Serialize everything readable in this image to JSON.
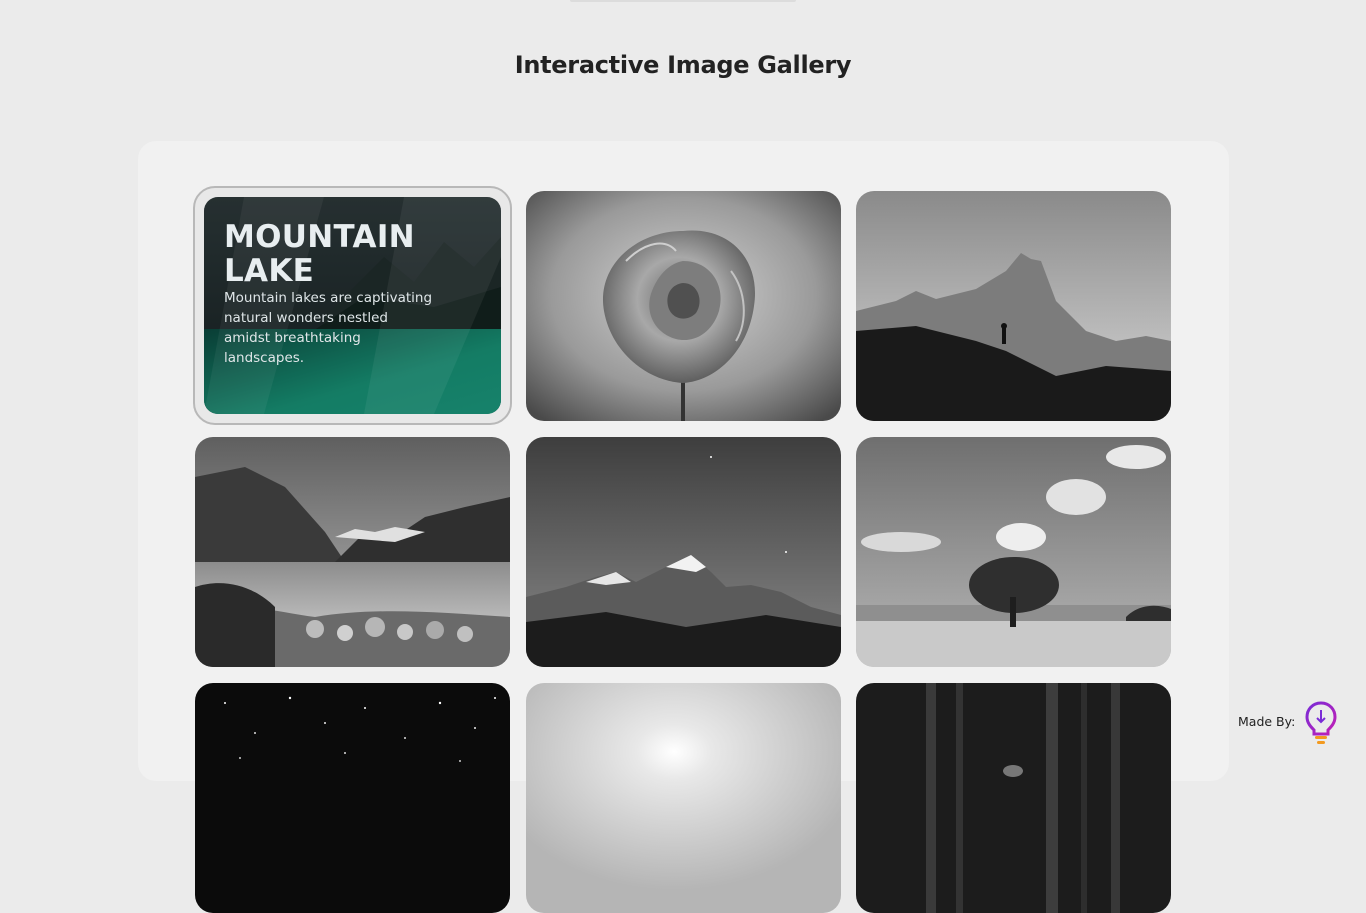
{
  "header": {
    "title": "Interactive Image Gallery"
  },
  "gallery": {
    "featured": {
      "title": "MOUNTAIN LAKE",
      "description": "Mountain lakes are captivating natural wonders nestled amidst breathtaking landscapes.",
      "accent": "#1fbf9a"
    },
    "images": [
      {
        "name": "mountain-lake"
      },
      {
        "name": "rose"
      },
      {
        "name": "mountain-peak-hiker"
      },
      {
        "name": "lake-reflection"
      },
      {
        "name": "snowy-peaks"
      },
      {
        "name": "tree-beach"
      },
      {
        "name": "starry-sky"
      },
      {
        "name": "sun-haze"
      },
      {
        "name": "dark-forest"
      }
    ]
  },
  "footer": {
    "made_by_label": "Made By:",
    "logo_icon": "lightbulb-icon"
  }
}
